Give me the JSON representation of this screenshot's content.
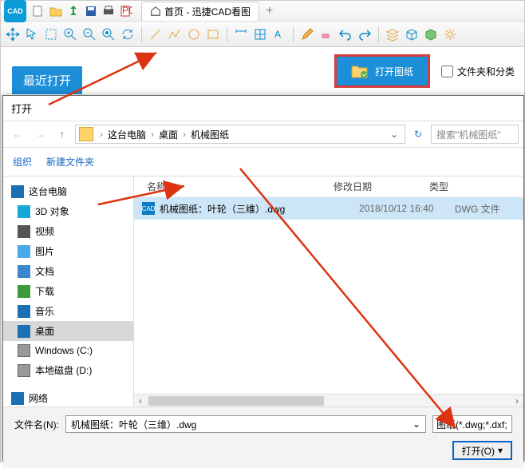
{
  "titlebar": {
    "tab_label": "首页 - 迅捷CAD看图"
  },
  "top": {
    "recent_label": "最近打开",
    "open_label": "打开图纸",
    "checkbox_label": "文件夹和分类"
  },
  "dialog": {
    "title": "打开",
    "path": {
      "p1": "这台电脑",
      "p2": "桌面",
      "p3": "机械图纸"
    },
    "search_placeholder": "搜索\"机械图纸\"",
    "organize": "组织",
    "new_folder": "新建文件夹",
    "cols": {
      "name": "名称",
      "date": "修改日期",
      "type": "类型"
    },
    "file": {
      "name": "机械图纸：叶轮（三维）.dwg",
      "date": "2018/10/12 16:40",
      "type": "DWG 文件"
    },
    "tree": {
      "pc": "这台电脑",
      "obj3d": "3D 对象",
      "video": "视频",
      "pic": "图片",
      "doc": "文档",
      "dl": "下载",
      "music": "音乐",
      "desk": "桌面",
      "winc": "Windows (C:)",
      "locd": "本地磁盘 (D:)",
      "net": "网络"
    },
    "filename_label": "文件名(N):",
    "filename_value": "机械图纸：叶轮（三维）.dwg",
    "filetype": "图纸(*.dwg;*.dxf;",
    "open_btn": "打开(O)"
  }
}
